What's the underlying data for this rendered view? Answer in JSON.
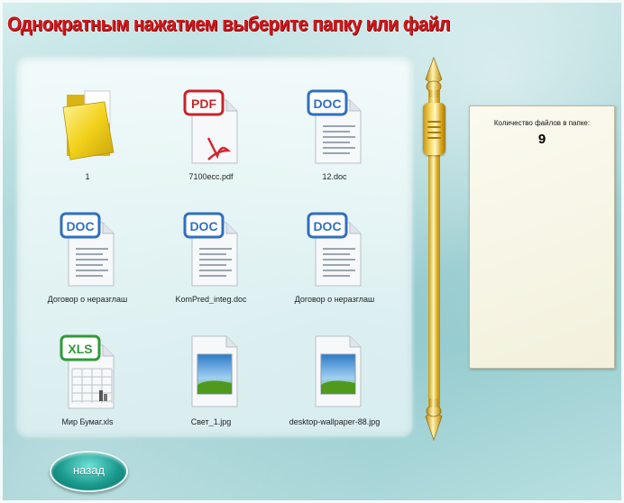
{
  "title": "Однократным нажатием выберите папку или файл",
  "files": [
    {
      "type": "folder",
      "badge": "",
      "name": "1"
    },
    {
      "type": "pdf",
      "badge": "PDF",
      "name": "7100ecc.pdf"
    },
    {
      "type": "doc",
      "badge": "DOC",
      "name": "12.doc"
    },
    {
      "type": "doc",
      "badge": "DOC",
      "name": "Договор о неразглаш"
    },
    {
      "type": "doc",
      "badge": "DOC",
      "name": "KomPred_integ.doc"
    },
    {
      "type": "doc",
      "badge": "DOC",
      "name": "Договор о неразглаш"
    },
    {
      "type": "xls",
      "badge": "XLS",
      "name": "Мир Бумаг.xls"
    },
    {
      "type": "image",
      "badge": "",
      "name": "Свет_1.jpg"
    },
    {
      "type": "image",
      "badge": "",
      "name": "desktop-wallpaper-88.jpg"
    }
  ],
  "info": {
    "label": "Количество файлов в папке:",
    "count": "9"
  },
  "back_label": "назад",
  "colors": {
    "title": "#d0181c",
    "pdf": "#c8242a",
    "doc": "#2f6fbf",
    "xls": "#2f9a3a"
  }
}
